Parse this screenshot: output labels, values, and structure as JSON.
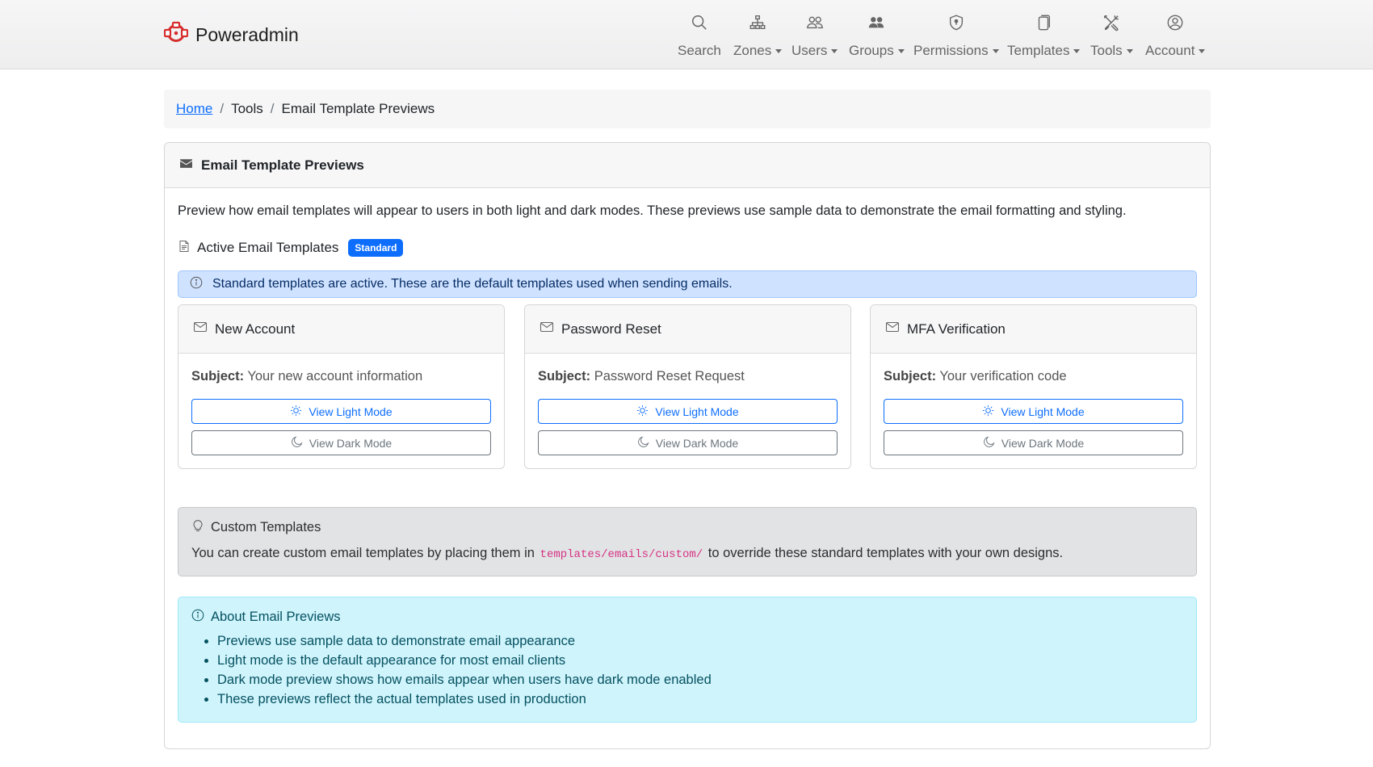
{
  "brand": {
    "name": "Poweradmin",
    "logo_icon": "poweradmin-logo",
    "accent": "#d62d2d"
  },
  "nav": [
    {
      "label": "Search",
      "icon": "search-icon",
      "dropdown": false
    },
    {
      "label": "Zones",
      "icon": "sitemap-icon",
      "dropdown": true
    },
    {
      "label": "Users",
      "icon": "people-icon",
      "dropdown": true
    },
    {
      "label": "Groups",
      "icon": "people-fill-icon",
      "dropdown": true
    },
    {
      "label": "Permissions",
      "icon": "shield-icon",
      "dropdown": true
    },
    {
      "label": "Templates",
      "icon": "files-icon",
      "dropdown": true
    },
    {
      "label": "Tools",
      "icon": "tools-icon",
      "dropdown": true
    },
    {
      "label": "Account",
      "icon": "person-circle-icon",
      "dropdown": true
    }
  ],
  "breadcrumb": {
    "home": "Home",
    "section": "Tools",
    "current": "Email Template Previews"
  },
  "card": {
    "title": "Email Template Previews",
    "intro": "Preview how email templates will appear to users in both light and dark modes. These previews use sample data to demonstrate the email formatting and styling.",
    "active_title": "Active Email Templates",
    "active_badge": "Standard",
    "active_alert": "Standard templates are active. These are the default templates used when sending emails."
  },
  "templates": [
    {
      "title": "New Account",
      "subject_label": "Subject:",
      "subject": "Your new account information",
      "light_label": "View Light Mode",
      "dark_label": "View Dark Mode"
    },
    {
      "title": "Password Reset",
      "subject_label": "Subject:",
      "subject": "Password Reset Request",
      "light_label": "View Light Mode",
      "dark_label": "View Dark Mode"
    },
    {
      "title": "MFA Verification",
      "subject_label": "Subject:",
      "subject": "Your verification code",
      "light_label": "View Light Mode",
      "dark_label": "View Dark Mode"
    }
  ],
  "custom": {
    "title": "Custom Templates",
    "text_before": "You can create custom email templates by placing them in",
    "path": "templates/emails/custom/",
    "text_after": "to override these standard templates with your own designs."
  },
  "about": {
    "title": "About Email Previews",
    "items": [
      "Previews use sample data to demonstrate email appearance",
      "Light mode is the default appearance for most email clients",
      "Dark mode preview shows how emails appear when users have dark mode enabled",
      "These previews reflect the actual templates used in production"
    ]
  },
  "colors": {
    "primary": "#0d6efd",
    "secondary": "#6c757d",
    "info_bg": "#cff4fc",
    "primary_alert_bg": "#cfe2ff",
    "code": "#d63384"
  }
}
